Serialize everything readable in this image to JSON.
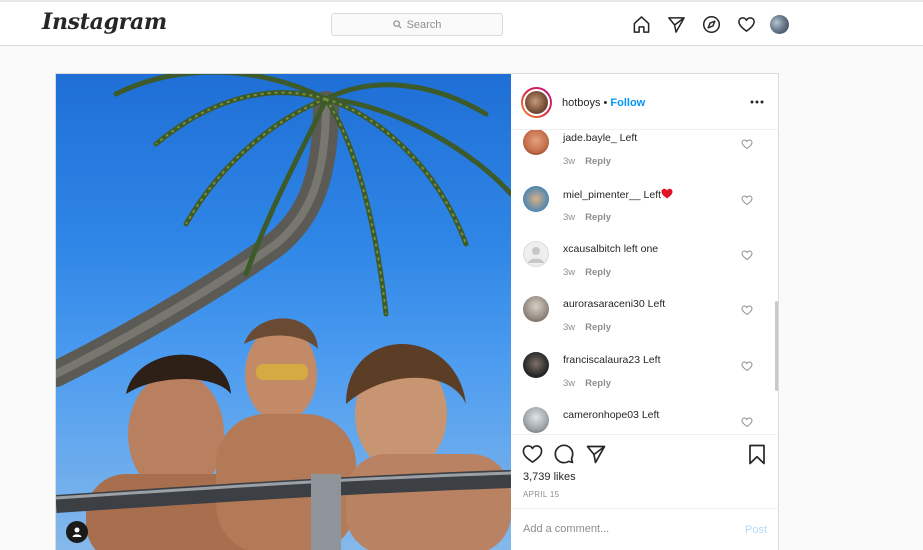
{
  "nav": {
    "logo": "Instagram",
    "search_placeholder": "Search"
  },
  "post": {
    "author": "hotboys",
    "separator": "•",
    "follow_label": "Follow",
    "likes": "3,739 likes",
    "date": "APRIL 15",
    "comment_placeholder": "Add a comment...",
    "post_label": "Post"
  },
  "comments": [
    {
      "user": "jade.bayle_",
      "text": "Left",
      "time": "3w",
      "reply": "Reply",
      "avatar_color": "#c7704d"
    },
    {
      "user": "miel_pimenter__",
      "text": "Left",
      "time": "3w",
      "reply": "Reply",
      "avatar_color": "#4f86b0",
      "emoji": "heart"
    },
    {
      "user": "xcausalbitch",
      "text": "left one",
      "time": "3w",
      "reply": "Reply",
      "avatar_color": "#efefef"
    },
    {
      "user": "aurorasaraceni30",
      "text": "Left",
      "time": "3w",
      "reply": "Reply",
      "avatar_color": "#9a8f86"
    },
    {
      "user": "franciscalaura23",
      "text": "Left",
      "time": "3w",
      "reply": "Reply",
      "avatar_color": "#2b2b2b"
    },
    {
      "user": "cameronhope03",
      "text": "Left",
      "time": "",
      "reply": "",
      "avatar_color": "#a3a8ad"
    }
  ]
}
